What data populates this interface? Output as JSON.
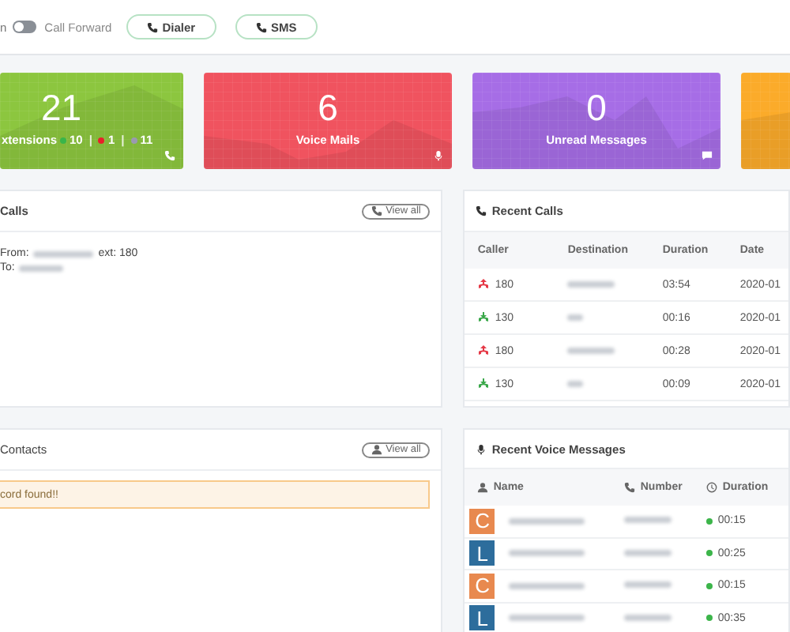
{
  "topbar": {
    "cut_label": "n",
    "call_forward": {
      "label": "Call Forward",
      "on": false
    },
    "buttons": [
      {
        "label": "Dialer"
      },
      {
        "label": "SMS"
      }
    ]
  },
  "stats": [
    {
      "kind": "extensions",
      "value": "21",
      "label": "xtensions",
      "color": "#8cc63f",
      "counts": [
        {
          "text": "10",
          "color": "#39b54a"
        },
        {
          "separator": "|",
          "text": "1",
          "color": "#e8202a"
        },
        {
          "separator": "|",
          "text": "11",
          "color": "#9a9ab0"
        }
      ]
    },
    {
      "kind": "voicemail",
      "value": "6",
      "label": "Voice Mails",
      "color": "#f0535f"
    },
    {
      "kind": "messages",
      "value": "0",
      "label": "Unread Messages",
      "color": "#a66de6"
    },
    {
      "kind": "other",
      "color": "#fbab2a"
    }
  ],
  "calls_panel": {
    "title": "Calls",
    "view_all": "View all",
    "from_label": "From:",
    "ext": "ext: 180",
    "to_label": "To:"
  },
  "recent_calls": {
    "title": "Recent Calls",
    "columns": [
      "Caller",
      "Destination",
      "Duration",
      "Date"
    ],
    "rows": [
      {
        "kind": "outgoing",
        "caller": "180",
        "duration": "03:54",
        "date": "2020-01"
      },
      {
        "kind": "incoming",
        "caller": "130",
        "duration": "00:16",
        "date": "2020-01"
      },
      {
        "kind": "outgoing",
        "caller": "180",
        "duration": "00:28",
        "date": "2020-01"
      },
      {
        "kind": "incoming",
        "caller": "130",
        "duration": "00:09",
        "date": "2020-01"
      }
    ]
  },
  "contacts_panel": {
    "title": "Contacts",
    "view_all": "View all",
    "alert": "cord found!!"
  },
  "voice_messages": {
    "title": "Recent Voice Messages",
    "columns": [
      "Name",
      "Number",
      "Duration"
    ],
    "rows": [
      {
        "initial": "C",
        "color": "#e8894f",
        "duration": "00:15"
      },
      {
        "initial": "L",
        "color": "#2d6d9c",
        "duration": "00:25"
      },
      {
        "initial": "C",
        "color": "#e8894f",
        "duration": "00:15"
      },
      {
        "initial": "L",
        "color": "#2d6d9c",
        "duration": "00:35"
      }
    ]
  }
}
